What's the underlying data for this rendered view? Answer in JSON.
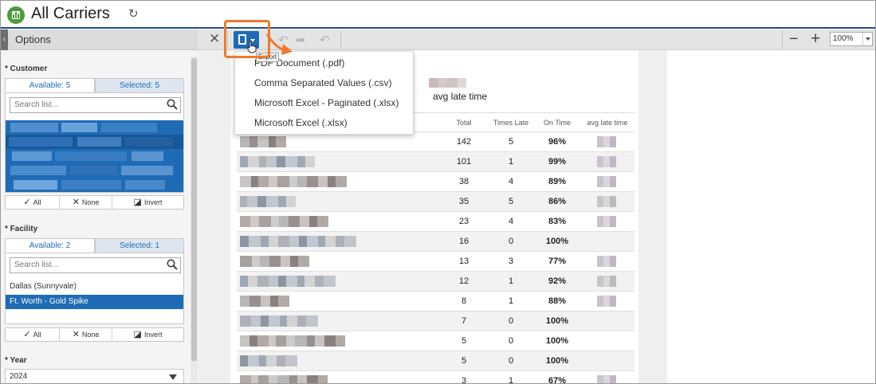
{
  "app": {
    "title": "All Carriers"
  },
  "options": {
    "title": "Options",
    "customer": {
      "label": "* Customer",
      "tab_available": "Available: 5",
      "tab_selected": "Selected: 5",
      "search_placeholder": "Search list...",
      "btn_all": "All",
      "btn_none": "None",
      "btn_invert": "Invert"
    },
    "facility": {
      "label": "* Facility",
      "tab_available": "Available: 2",
      "tab_selected": "Selected: 1",
      "search_placeholder": "Search list...",
      "items": [
        "Dallas (Sunnyvale)",
        "Ft. Worth - Gold Spike"
      ],
      "btn_all": "All",
      "btn_none": "None",
      "btn_invert": "Invert"
    },
    "year": {
      "label": "* Year",
      "value": "2024"
    }
  },
  "toolbar": {
    "zoom": "100%",
    "tooltip": "Export"
  },
  "export_menu": {
    "items": [
      "PDF Document (.pdf)",
      "Comma Separated Values (.csv)",
      "Microsoft Excel - Paginated (.xlsx)",
      "Microsoft Excel (.xlsx)"
    ]
  },
  "report": {
    "heading": "avg late time",
    "columns": [
      "Total",
      "Times Late",
      "On Time",
      "avg late time"
    ],
    "rows": [
      {
        "total": "142",
        "late": "5",
        "ontime": "96%"
      },
      {
        "total": "101",
        "late": "1",
        "ontime": "99%"
      },
      {
        "total": "38",
        "late": "4",
        "ontime": "89%"
      },
      {
        "total": "35",
        "late": "5",
        "ontime": "86%"
      },
      {
        "total": "23",
        "late": "4",
        "ontime": "83%"
      },
      {
        "total": "16",
        "late": "0",
        "ontime": "100%"
      },
      {
        "total": "13",
        "late": "3",
        "ontime": "77%"
      },
      {
        "total": "12",
        "late": "1",
        "ontime": "92%"
      },
      {
        "total": "8",
        "late": "1",
        "ontime": "88%"
      },
      {
        "total": "7",
        "late": "0",
        "ontime": "100%"
      },
      {
        "total": "5",
        "late": "0",
        "ontime": "100%"
      },
      {
        "total": "5",
        "late": "0",
        "ontime": "100%"
      },
      {
        "total": "3",
        "late": "1",
        "ontime": "67%"
      }
    ]
  },
  "colors": {
    "accent": "#1f6bb5",
    "header_rule": "#1f4e8c",
    "highlight": "#f07a2a",
    "logo": "#4c9a3c"
  }
}
